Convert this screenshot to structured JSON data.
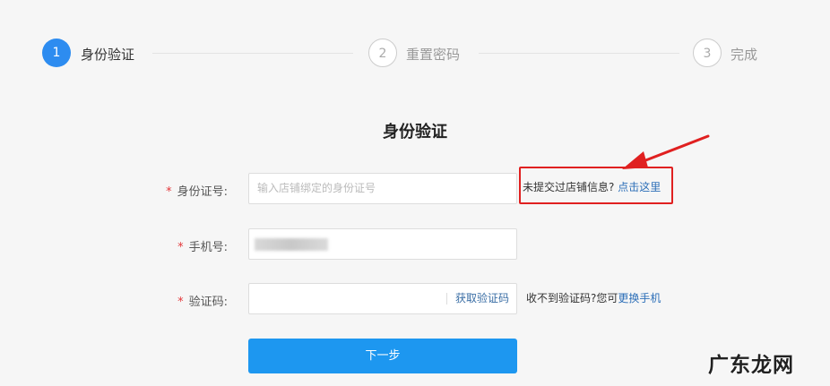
{
  "steps": [
    {
      "number": "1",
      "label": "身份验证",
      "state": "active"
    },
    {
      "number": "2",
      "label": "重置密码",
      "state": "inactive"
    },
    {
      "number": "3",
      "label": "完成",
      "state": "inactive"
    }
  ],
  "form": {
    "title": "身份验证",
    "required_mark": "*",
    "id_number": {
      "label": "身份证号:",
      "placeholder": "输入店铺绑定的身份证号",
      "hint_text": "未提交过店铺信息?",
      "hint_link": "点击这里"
    },
    "phone": {
      "label": "手机号:"
    },
    "code": {
      "label": "验证码:",
      "get_code_button": "获取验证码",
      "hint_text": "收不到验证码?您可",
      "hint_link": "更换手机"
    },
    "next_button": "下一步"
  },
  "watermark": "广东龙网",
  "colors": {
    "accent": "#2d8cf0",
    "submit": "#1d97f0",
    "required": "#e4393c",
    "annotation": "#e02020",
    "link": "#2d6fb8"
  }
}
